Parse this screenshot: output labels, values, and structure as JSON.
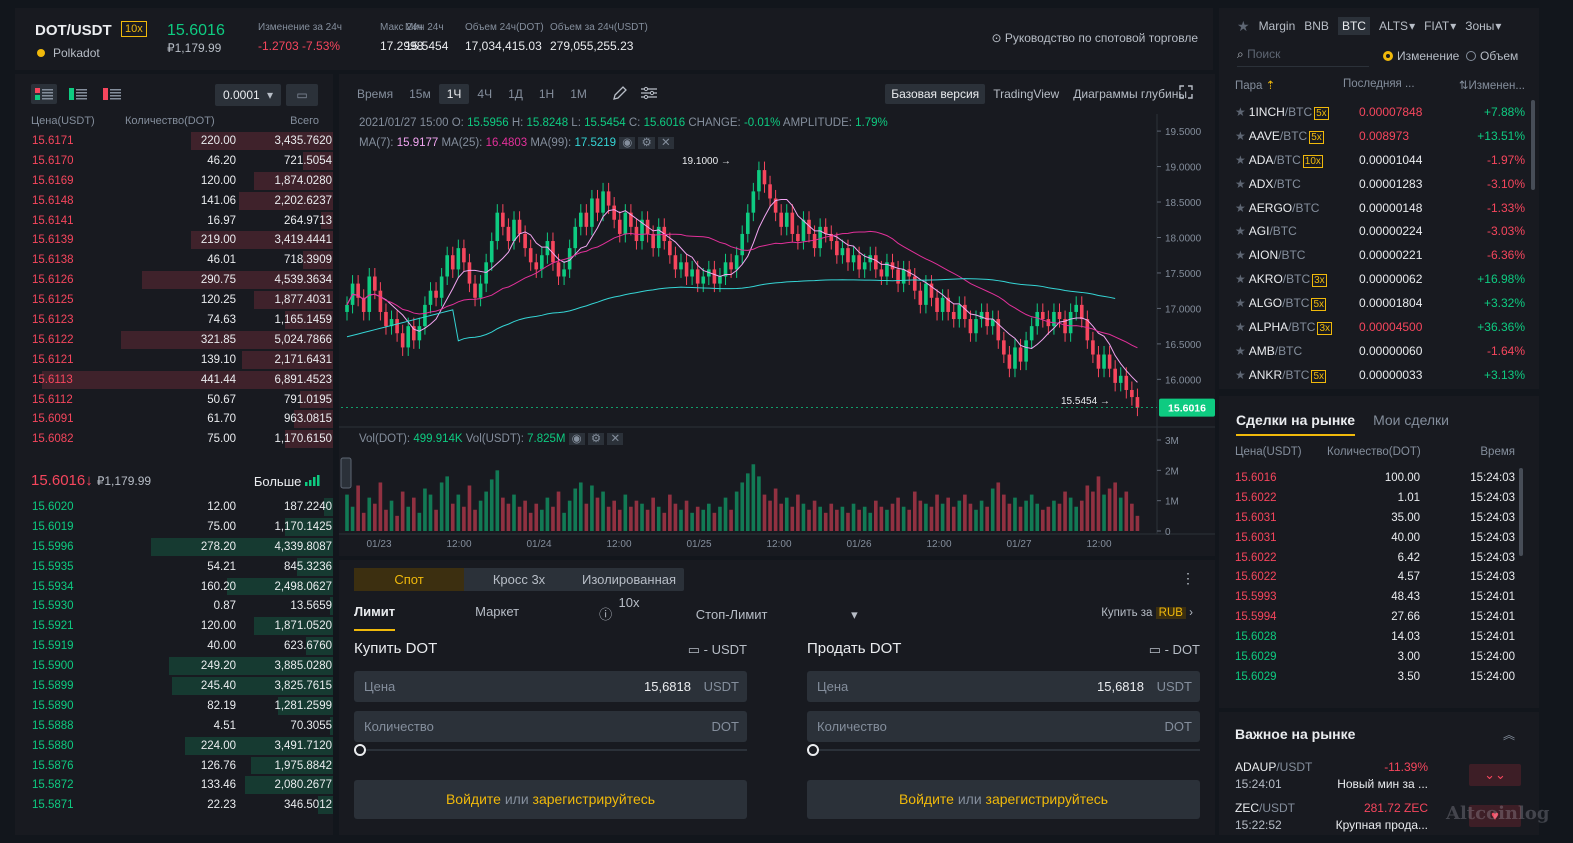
{
  "header": {
    "symbol": "DOT/USDT",
    "leverage": "10x",
    "coin_name": "Polkadot",
    "last_price": "15.6016",
    "last_price_rub": "₽1,179.99",
    "stats": [
      {
        "label": "Изменение за 24ч",
        "value": "-1.2703 -7.53%",
        "negative": true
      },
      {
        "label": "Макс 24ч",
        "value": "17.2998"
      },
      {
        "label": "Мин 24ч",
        "value": "15.5454"
      },
      {
        "label": "Объем 24ч(DOT)",
        "value": "17,034,415.03"
      },
      {
        "label": "Объем за 24ч(USDT)",
        "value": "279,055,255.23"
      }
    ],
    "guide_link": "Руководство по спотовой торговле"
  },
  "orderbook": {
    "precision": "0.0001",
    "columns": [
      "Цена(USDT)",
      "Количество(DOT)",
      "Всего"
    ],
    "asks": [
      {
        "p": "15.6171",
        "q": "220.00",
        "t": "3,435.7620",
        "d": 0.47
      },
      {
        "p": "15.6170",
        "q": "46.20",
        "t": "721.5054",
        "d": 0.1
      },
      {
        "p": "15.6169",
        "q": "120.00",
        "t": "1,874.0280",
        "d": 0.26
      },
      {
        "p": "15.6148",
        "q": "141.06",
        "t": "2,202.6237",
        "d": 0.31
      },
      {
        "p": "15.6141",
        "q": "16.97",
        "t": "264.9713",
        "d": 0.04
      },
      {
        "p": "15.6139",
        "q": "219.00",
        "t": "3,419.4441",
        "d": 0.47
      },
      {
        "p": "15.6138",
        "q": "46.01",
        "t": "718.3909",
        "d": 0.1
      },
      {
        "p": "15.6126",
        "q": "290.75",
        "t": "4,539.3634",
        "d": 0.63
      },
      {
        "p": "15.6125",
        "q": "120.25",
        "t": "1,877.4031",
        "d": 0.26
      },
      {
        "p": "15.6123",
        "q": "74.63",
        "t": "1,165.1459",
        "d": 0.16
      },
      {
        "p": "15.6122",
        "q": "321.85",
        "t": "5,024.7866",
        "d": 0.7
      },
      {
        "p": "15.6121",
        "q": "139.10",
        "t": "2,171.6431",
        "d": 0.3
      },
      {
        "p": "15.6113",
        "q": "441.44",
        "t": "6,891.4523",
        "d": 0.96
      },
      {
        "p": "15.6112",
        "q": "50.67",
        "t": "791.0195",
        "d": 0.11
      },
      {
        "p": "15.6091",
        "q": "61.70",
        "t": "963.0815",
        "d": 0.13
      },
      {
        "p": "15.6082",
        "q": "75.00",
        "t": "1,170.6150",
        "d": 0.16
      }
    ],
    "mid_price": "15.6016",
    "mid_arrow": "↓",
    "mid_rub": "₽1,179.99",
    "more_label": "Больше",
    "bids": [
      {
        "p": "15.6020",
        "q": "12.00",
        "t": "187.2240",
        "d": 0.03
      },
      {
        "p": "15.6019",
        "q": "75.00",
        "t": "1,170.1425",
        "d": 0.16
      },
      {
        "p": "15.5996",
        "q": "278.20",
        "t": "4,339.8087",
        "d": 0.6
      },
      {
        "p": "15.5935",
        "q": "54.21",
        "t": "845.3236",
        "d": 0.12
      },
      {
        "p": "15.5934",
        "q": "160.20",
        "t": "2,498.0627",
        "d": 0.35
      },
      {
        "p": "15.5930",
        "q": "0.87",
        "t": "13.5659",
        "d": 0.01
      },
      {
        "p": "15.5921",
        "q": "120.00",
        "t": "1,871.0520",
        "d": 0.26
      },
      {
        "p": "15.5919",
        "q": "40.00",
        "t": "623.6760",
        "d": 0.09
      },
      {
        "p": "15.5900",
        "q": "249.20",
        "t": "3,885.0280",
        "d": 0.54
      },
      {
        "p": "15.5899",
        "q": "245.40",
        "t": "3,825.7615",
        "d": 0.53
      },
      {
        "p": "15.5890",
        "q": "82.19",
        "t": "1,281.2599",
        "d": 0.18
      },
      {
        "p": "15.5888",
        "q": "4.51",
        "t": "70.3055",
        "d": 0.01
      },
      {
        "p": "15.5880",
        "q": "224.00",
        "t": "3,491.7120",
        "d": 0.49
      },
      {
        "p": "15.5876",
        "q": "126.76",
        "t": "1,975.8842",
        "d": 0.27
      },
      {
        "p": "15.5872",
        "q": "133.46",
        "t": "2,080.2677",
        "d": 0.29
      },
      {
        "p": "15.5871",
        "q": "22.23",
        "t": "346.5012",
        "d": 0.05
      }
    ]
  },
  "chart": {
    "timeframes": [
      "Время",
      "15м",
      "1Ч",
      "4Ч",
      "1Д",
      "1Н",
      "1М"
    ],
    "active_timeframe": "1Ч",
    "views": [
      "Базовая версия",
      "TradingView",
      "Диаграммы глубины"
    ],
    "ohlc": {
      "date": "2021/01/27 15:00",
      "o": "15.5956",
      "h": "15.8248",
      "l": "15.5454",
      "c": "15.6016",
      "change": "-0.01%",
      "amplitude": "1.79%"
    },
    "ma": {
      "ma7": "15.9177",
      "ma25": "16.4803",
      "ma99": "17.5219"
    },
    "vol": {
      "dot": "499.914K",
      "usdt": "7.825M"
    },
    "high_marker": "19.1000",
    "low_marker": "15.5454",
    "price_tag": "15.6016",
    "colors": {
      "up": "#0ecb81",
      "down": "#f6465d",
      "ma7": "#f3a6f2",
      "ma25": "#e2309a",
      "ma99": "#35d5d5"
    }
  },
  "chart_data": {
    "type": "candlestick",
    "title": "DOT/USDT 1H",
    "y_ticks": [
      "19.5000",
      "19.0000",
      "18.5000",
      "18.0000",
      "17.5000",
      "17.0000",
      "16.5000",
      "16.0000"
    ],
    "ylim": [
      15.3,
      19.6
    ],
    "vol_ticks": [
      "3M",
      "2M",
      "1M",
      "0"
    ],
    "x_ticks": [
      "01/23",
      "12:00",
      "01/24",
      "12:00",
      "01/25",
      "12:00",
      "01/26",
      "12:00",
      "01/27",
      "12:00"
    ],
    "close": [
      17.05,
      17.35,
      17.15,
      16.95,
      17.45,
      17.25,
      16.95,
      16.75,
      16.85,
      16.65,
      16.45,
      16.75,
      16.55,
      16.75,
      17.05,
      17.25,
      17.15,
      17.45,
      17.75,
      17.55,
      17.85,
      17.65,
      17.35,
      17.15,
      17.35,
      17.65,
      17.95,
      18.35,
      18.15,
      17.95,
      18.25,
      18.05,
      17.85,
      17.65,
      17.55,
      17.75,
      17.95,
      17.65,
      17.45,
      17.55,
      17.85,
      18.15,
      18.35,
      18.15,
      18.55,
      18.35,
      18.65,
      18.45,
      18.25,
      18.05,
      18.35,
      18.15,
      17.95,
      18.25,
      18.05,
      17.85,
      18.15,
      17.95,
      17.75,
      17.55,
      17.65,
      17.45,
      17.55,
      17.35,
      17.45,
      17.55,
      17.35,
      17.45,
      17.65,
      17.55,
      17.75,
      18.05,
      18.35,
      18.65,
      18.95,
      18.75,
      18.55,
      18.35,
      18.15,
      18.35,
      18.05,
      17.95,
      18.25,
      18.05,
      17.85,
      18.15,
      18.05,
      17.95,
      17.75,
      17.85,
      17.65,
      17.75,
      17.55,
      17.65,
      17.75,
      17.55,
      17.45,
      17.65,
      17.55,
      17.35,
      17.55,
      17.45,
      17.25,
      17.05,
      17.35,
      17.15,
      16.95,
      17.15,
      16.95,
      16.85,
      17.05,
      16.85,
      16.65,
      16.85,
      16.95,
      16.75,
      16.85,
      16.55,
      16.35,
      16.15,
      16.45,
      16.25,
      16.55,
      16.75,
      16.95,
      16.85,
      16.75,
      16.95,
      16.85,
      16.65,
      16.95,
      17.05,
      16.85,
      16.55,
      16.35,
      16.15,
      16.35,
      16.15,
      15.95,
      16.05,
      15.85,
      15.75,
      15.6016
    ],
    "volume": [
      1.2,
      0.8,
      1.5,
      0.6,
      1.1,
      0.9,
      1.6,
      0.7,
      1.0,
      0.5,
      1.3,
      0.8,
      1.1,
      0.6,
      1.4,
      1.2,
      0.7,
      1.6,
      1.8,
      0.9,
      1.2,
      0.8,
      1.5,
      0.7,
      1.0,
      1.3,
      1.7,
      2.0,
      1.1,
      0.9,
      1.2,
      0.8,
      1.0,
      0.6,
      0.9,
      0.7,
      1.1,
      0.8,
      1.3,
      0.6,
      1.0,
      1.4,
      1.6,
      0.9,
      1.5,
      1.1,
      1.3,
      0.8,
      1.0,
      0.7,
      1.2,
      0.8,
      1.0,
      0.9,
      0.7,
      1.1,
      0.8,
      0.6,
      1.2,
      0.9,
      0.7,
      1.0,
      0.6,
      0.8,
      0.7,
      0.9,
      0.6,
      0.8,
      1.1,
      0.7,
      1.3,
      1.6,
      1.9,
      2.2,
      1.8,
      1.2,
      1.0,
      1.4,
      0.9,
      1.1,
      0.8,
      1.2,
      0.9,
      0.7,
      1.0,
      0.8,
      0.6,
      0.9,
      0.7,
      0.8,
      0.6,
      0.9,
      0.7,
      0.8,
      0.6,
      1.0,
      0.8,
      0.7,
      0.9,
      1.1,
      0.8,
      0.7,
      1.3,
      1.0,
      0.9,
      0.8,
      1.2,
      0.9,
      1.1,
      0.8,
      1.0,
      1.2,
      0.9,
      0.7,
      1.0,
      0.8,
      1.4,
      1.6,
      1.2,
      0.9,
      1.1,
      0.8,
      1.0,
      1.2,
      0.9,
      0.7,
      0.8,
      1.0,
      0.9,
      1.3,
      1.1,
      0.8,
      1.0,
      1.5,
      1.3,
      1.8,
      1.2,
      1.4,
      1.6,
      1.1,
      1.3,
      0.9,
      0.5
    ]
  },
  "tradeform": {
    "modes": [
      "Спот",
      "Кросс 3x",
      "Изолированная 10x"
    ],
    "order_types": [
      "Лимит",
      "Маркет",
      "Стоп-Лимит"
    ],
    "buy_for": "Купить за",
    "buy_for_ccy": "RUB",
    "buy": {
      "title": "Купить DOT",
      "balance": "- USDT",
      "price_label": "Цена",
      "price": "15,6818",
      "price_unit": "USDT",
      "qty_label": "Количество",
      "qty_unit": "DOT"
    },
    "sell": {
      "title": "Продать DOT",
      "balance": "- DOT",
      "price_label": "Цена",
      "price": "15,6818",
      "price_unit": "USDT",
      "qty_label": "Количество",
      "qty_unit": "DOT"
    },
    "login": "Войдите",
    "or": "или",
    "register": "зарегистрируйтесь"
  },
  "markets": {
    "tabs": [
      "Margin",
      "BNB",
      "BTC",
      "ALTS",
      "FIAT",
      "Зоны"
    ],
    "active_tab": "BTC",
    "search_placeholder": "Поиск",
    "radio_change": "Изменение",
    "radio_volume": "Объем",
    "columns": [
      "Пара",
      "Последняя ...",
      "Изменен..."
    ],
    "rows": [
      {
        "base": "1INCH",
        "quote": "/BTC",
        "lev": "5x",
        "last": "0.00007848",
        "chg": "+7.88%",
        "last_neg": true,
        "chg_neg": false
      },
      {
        "base": "AAVE",
        "quote": "/BTC",
        "lev": "5x",
        "last": "0.008973",
        "chg": "+13.51%",
        "last_neg": true,
        "chg_neg": false
      },
      {
        "base": "ADA",
        "quote": "/BTC",
        "lev": "10x",
        "last": "0.00001044",
        "chg": "-1.97%",
        "last_neg": false,
        "chg_neg": true
      },
      {
        "base": "ADX",
        "quote": "/BTC",
        "lev": "",
        "last": "0.00001283",
        "chg": "-3.10%",
        "last_neg": false,
        "chg_neg": true
      },
      {
        "base": "AERGO",
        "quote": "/BTC",
        "lev": "",
        "last": "0.00000148",
        "chg": "-1.33%",
        "last_neg": false,
        "chg_neg": true
      },
      {
        "base": "AGI",
        "quote": "/BTC",
        "lev": "",
        "last": "0.00000224",
        "chg": "-3.03%",
        "last_neg": false,
        "chg_neg": true
      },
      {
        "base": "AION",
        "quote": "/BTC",
        "lev": "",
        "last": "0.00000221",
        "chg": "-6.36%",
        "last_neg": false,
        "chg_neg": true
      },
      {
        "base": "AKRO",
        "quote": "/BTC",
        "lev": "3x",
        "last": "0.00000062",
        "chg": "+16.98%",
        "last_neg": false,
        "chg_neg": false
      },
      {
        "base": "ALGO",
        "quote": "/BTC",
        "lev": "5x",
        "last": "0.00001804",
        "chg": "+3.32%",
        "last_neg": false,
        "chg_neg": false
      },
      {
        "base": "ALPHA",
        "quote": "/BTC",
        "lev": "3x",
        "last": "0.00004500",
        "chg": "+36.36%",
        "last_neg": true,
        "chg_neg": false
      },
      {
        "base": "AMB",
        "quote": "/BTC",
        "lev": "",
        "last": "0.00000060",
        "chg": "-1.64%",
        "last_neg": false,
        "chg_neg": true
      },
      {
        "base": "ANKR",
        "quote": "/BTC",
        "lev": "5x",
        "last": "0.00000033",
        "chg": "+3.13%",
        "last_neg": false,
        "chg_neg": false
      }
    ]
  },
  "trades": {
    "tabs": [
      "Сделки на рынке",
      "Мои сделки"
    ],
    "columns": [
      "Цена(USDT)",
      "Количество(DOT)",
      "Время"
    ],
    "rows": [
      {
        "p": "15.6016",
        "q": "100.00",
        "t": "15:24:03",
        "up": false
      },
      {
        "p": "15.6022",
        "q": "1.01",
        "t": "15:24:03",
        "up": false
      },
      {
        "p": "15.6031",
        "q": "35.00",
        "t": "15:24:03",
        "up": false
      },
      {
        "p": "15.6031",
        "q": "40.00",
        "t": "15:24:03",
        "up": false
      },
      {
        "p": "15.6022",
        "q": "6.42",
        "t": "15:24:03",
        "up": false
      },
      {
        "p": "15.6022",
        "q": "4.57",
        "t": "15:24:03",
        "up": false
      },
      {
        "p": "15.5993",
        "q": "48.43",
        "t": "15:24:01",
        "up": false
      },
      {
        "p": "15.5994",
        "q": "27.66",
        "t": "15:24:01",
        "up": false
      },
      {
        "p": "15.6028",
        "q": "14.03",
        "t": "15:24:01",
        "up": true
      },
      {
        "p": "15.6029",
        "q": "3.00",
        "t": "15:24:00",
        "up": true
      },
      {
        "p": "15.6029",
        "q": "3.50",
        "t": "15:24:00",
        "up": true
      }
    ]
  },
  "movers": {
    "title": "Важное на рынке",
    "items": [
      {
        "sym": "ADAUP",
        "quote": "/USDT",
        "time": "15:24:01",
        "chg": "-11.39%",
        "desc": "Новый мин за ..."
      },
      {
        "sym": "ZEC",
        "quote": "/USDT",
        "time": "15:22:52",
        "chg": "281.72 ZEC",
        "desc": "Крупная прода..."
      }
    ]
  },
  "watermark": "Altcoinlog"
}
